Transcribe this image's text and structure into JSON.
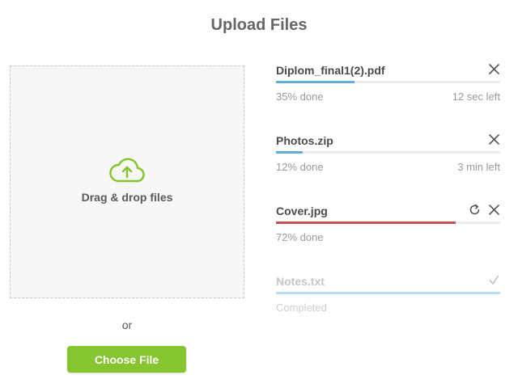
{
  "title": "Upload Files",
  "dropzone": {
    "label": "Drag & drop files",
    "icon": "cloud-upload-icon"
  },
  "or_text": "or",
  "choose_button": "Choose File",
  "colors": {
    "accent": "#86c430",
    "progress": "#5dade0",
    "error": "#c85050",
    "completed": "#b9def3"
  },
  "files": [
    {
      "name": "Diplom_final1(2).pdf",
      "status": "35% done",
      "remaining": "12 sec left",
      "progress": 0.35,
      "state": "uploading",
      "actions": [
        "close-icon"
      ]
    },
    {
      "name": "Photos.zip",
      "status": "12% done",
      "remaining": "3 min left",
      "progress": 0.12,
      "state": "uploading",
      "actions": [
        "close-icon"
      ]
    },
    {
      "name": "Cover.jpg",
      "status": "72% done",
      "remaining": "",
      "progress": 0.8,
      "state": "error",
      "actions": [
        "retry-icon",
        "close-icon"
      ]
    },
    {
      "name": "Notes.txt",
      "status": "Completed",
      "remaining": "",
      "progress": 1.0,
      "state": "completed",
      "actions": [
        "checkmark-icon"
      ]
    }
  ]
}
